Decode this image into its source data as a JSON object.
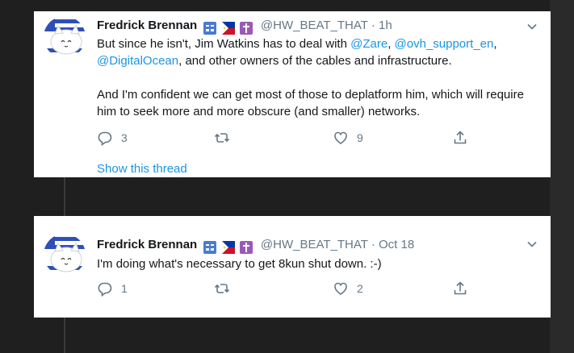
{
  "tweets": [
    {
      "author_name": "Fredrick Brennan",
      "handle": "@HW_BEAT_THAT",
      "time": "· 1h",
      "body": {
        "line1_prefix": "But since he isn't, Jim Watkins has to deal with ",
        "mention_zare": "@Zare",
        "sep1": ", ",
        "mention_ovh": "@ovh_support_en",
        "sep2": ",",
        "mention_do": "@DigitalOcean",
        "line2_suffix": ", and other owners of the cables and infrastructure.",
        "para2": "And I'm confident we can get most of those to deplatform him, which will require him to seek more and more obscure (and smaller) networks."
      },
      "reply_count": "3",
      "retweet_count": "",
      "like_count": "9",
      "show_thread": "Show this thread"
    },
    {
      "author_name": "Fredrick Brennan",
      "handle": "@HW_BEAT_THAT",
      "time": "· Oct 18",
      "body": {
        "text": "I'm doing what's necessary to get 8kun shut down. :-)"
      },
      "reply_count": "1",
      "retweet_count": "",
      "like_count": "2"
    }
  ],
  "icons": {
    "reply": "reply-icon",
    "retweet": "retweet-icon",
    "like": "heart-icon",
    "share": "share-icon",
    "more": "chevron-down-icon",
    "flag1": "accessibility-flag-icon",
    "flag2": "philippines-flag-icon",
    "flag3": "cross-icon"
  },
  "colors": {
    "link": "#1b95e0",
    "secondary": "#657786",
    "primary_text": "#14171a",
    "background": "#1f1f1f",
    "card": "#ffffff"
  }
}
